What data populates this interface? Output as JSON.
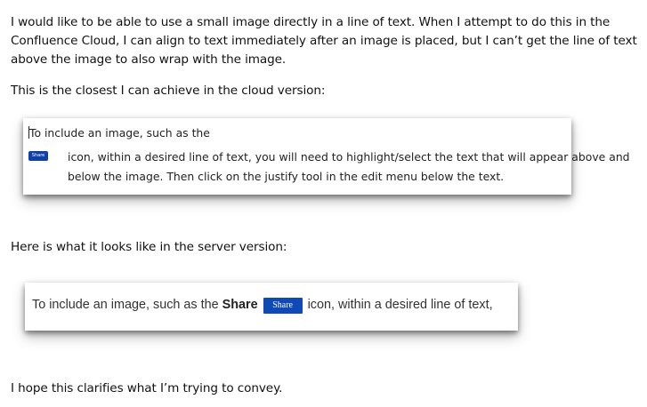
{
  "paragraphs": {
    "intro": "I would like to be able to use a small image directly in a line of text. When I attempt to do this in the Confluence Cloud, I can align to text immediately after an image is placed, but I can’t get the line of text above the image to also wrap with the image.",
    "cloud_caption": "This is the closest I can achieve in the cloud version:",
    "server_caption": "Here is what it looks like in the server version:",
    "closing": "I hope this clarifies what I’m trying to convey."
  },
  "cloud_screenshot": {
    "line1": "To include an image, such as the",
    "share_icon_label": "Share",
    "line2": "icon, within a desired line of text, you will need to highlight/select the text that will appear above and",
    "line3": "below the image. Then click on the justify tool in the edit menu below the text."
  },
  "server_screenshot": {
    "before": "To include an image, such as the",
    "bold_word": "Share",
    "share_icon_label": "Share",
    "after": "icon, within a desired line of text,"
  },
  "colors": {
    "share_button_bg": "#0f49b5"
  }
}
